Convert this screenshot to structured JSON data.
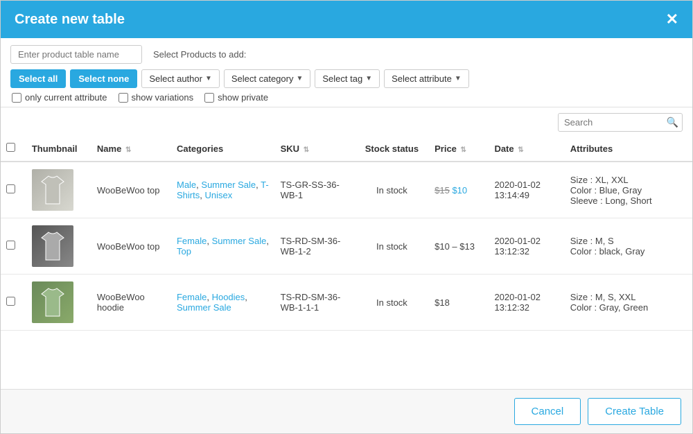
{
  "header": {
    "title": "Create new table",
    "close_label": "✕"
  },
  "controls": {
    "table_name_placeholder": "Enter product table name",
    "select_products_label": "Select Products to add:",
    "select_all_label": "Select all",
    "select_none_label": "Select none",
    "select_author_label": "Select author",
    "select_category_label": "Select category",
    "select_tag_label": "Select tag",
    "select_attribute_label": "Select attribute",
    "only_current_attribute_label": "only current attribute",
    "show_variations_label": "show variations",
    "show_private_label": "show private"
  },
  "search": {
    "placeholder": "Search"
  },
  "table": {
    "columns": [
      {
        "key": "check",
        "label": ""
      },
      {
        "key": "thumbnail",
        "label": "Thumbnail"
      },
      {
        "key": "name",
        "label": "Name"
      },
      {
        "key": "categories",
        "label": "Categories"
      },
      {
        "key": "sku",
        "label": "SKU"
      },
      {
        "key": "stock_status",
        "label": "Stock status"
      },
      {
        "key": "price",
        "label": "Price"
      },
      {
        "key": "date",
        "label": "Date"
      },
      {
        "key": "attributes",
        "label": "Attributes"
      }
    ],
    "rows": [
      {
        "id": 1,
        "name": "WooBeWoo top",
        "categories": [
          "Male",
          "Summer Sale",
          "T-Shirts",
          "Unisex"
        ],
        "sku": "TS-GR-SS-36-WB-1",
        "stock_status": "In stock",
        "price_old": "$15",
        "price_new": "$10",
        "date": "2020-01-02 13:14:49",
        "attributes": "Size : XL, XXL\nColor : Blue, Gray\nSleeve : Long, Short",
        "thumb_type": "tshirt"
      },
      {
        "id": 2,
        "name": "WooBeWoo top",
        "categories": [
          "Female",
          "Summer Sale",
          "Top"
        ],
        "sku": "TS-RD-SM-36-WB-1-2",
        "stock_status": "In stock",
        "price_range": "$10 – $13",
        "date": "2020-01-02 13:12:32",
        "attributes": "Size : M, S\nColor : black, Gray",
        "thumb_type": "dark"
      },
      {
        "id": 3,
        "name": "WooBeWoo hoodie",
        "categories": [
          "Female",
          "Hoodies",
          "Summer Sale"
        ],
        "sku": "TS-RD-SM-36-WB-1-1-1",
        "stock_status": "In stock",
        "price_single": "$18",
        "date": "2020-01-02 13:12:32",
        "attributes": "Size : M, S, XXL\nColor : Gray, Green",
        "thumb_type": "green"
      }
    ]
  },
  "footer": {
    "cancel_label": "Cancel",
    "create_label": "Create Table"
  }
}
